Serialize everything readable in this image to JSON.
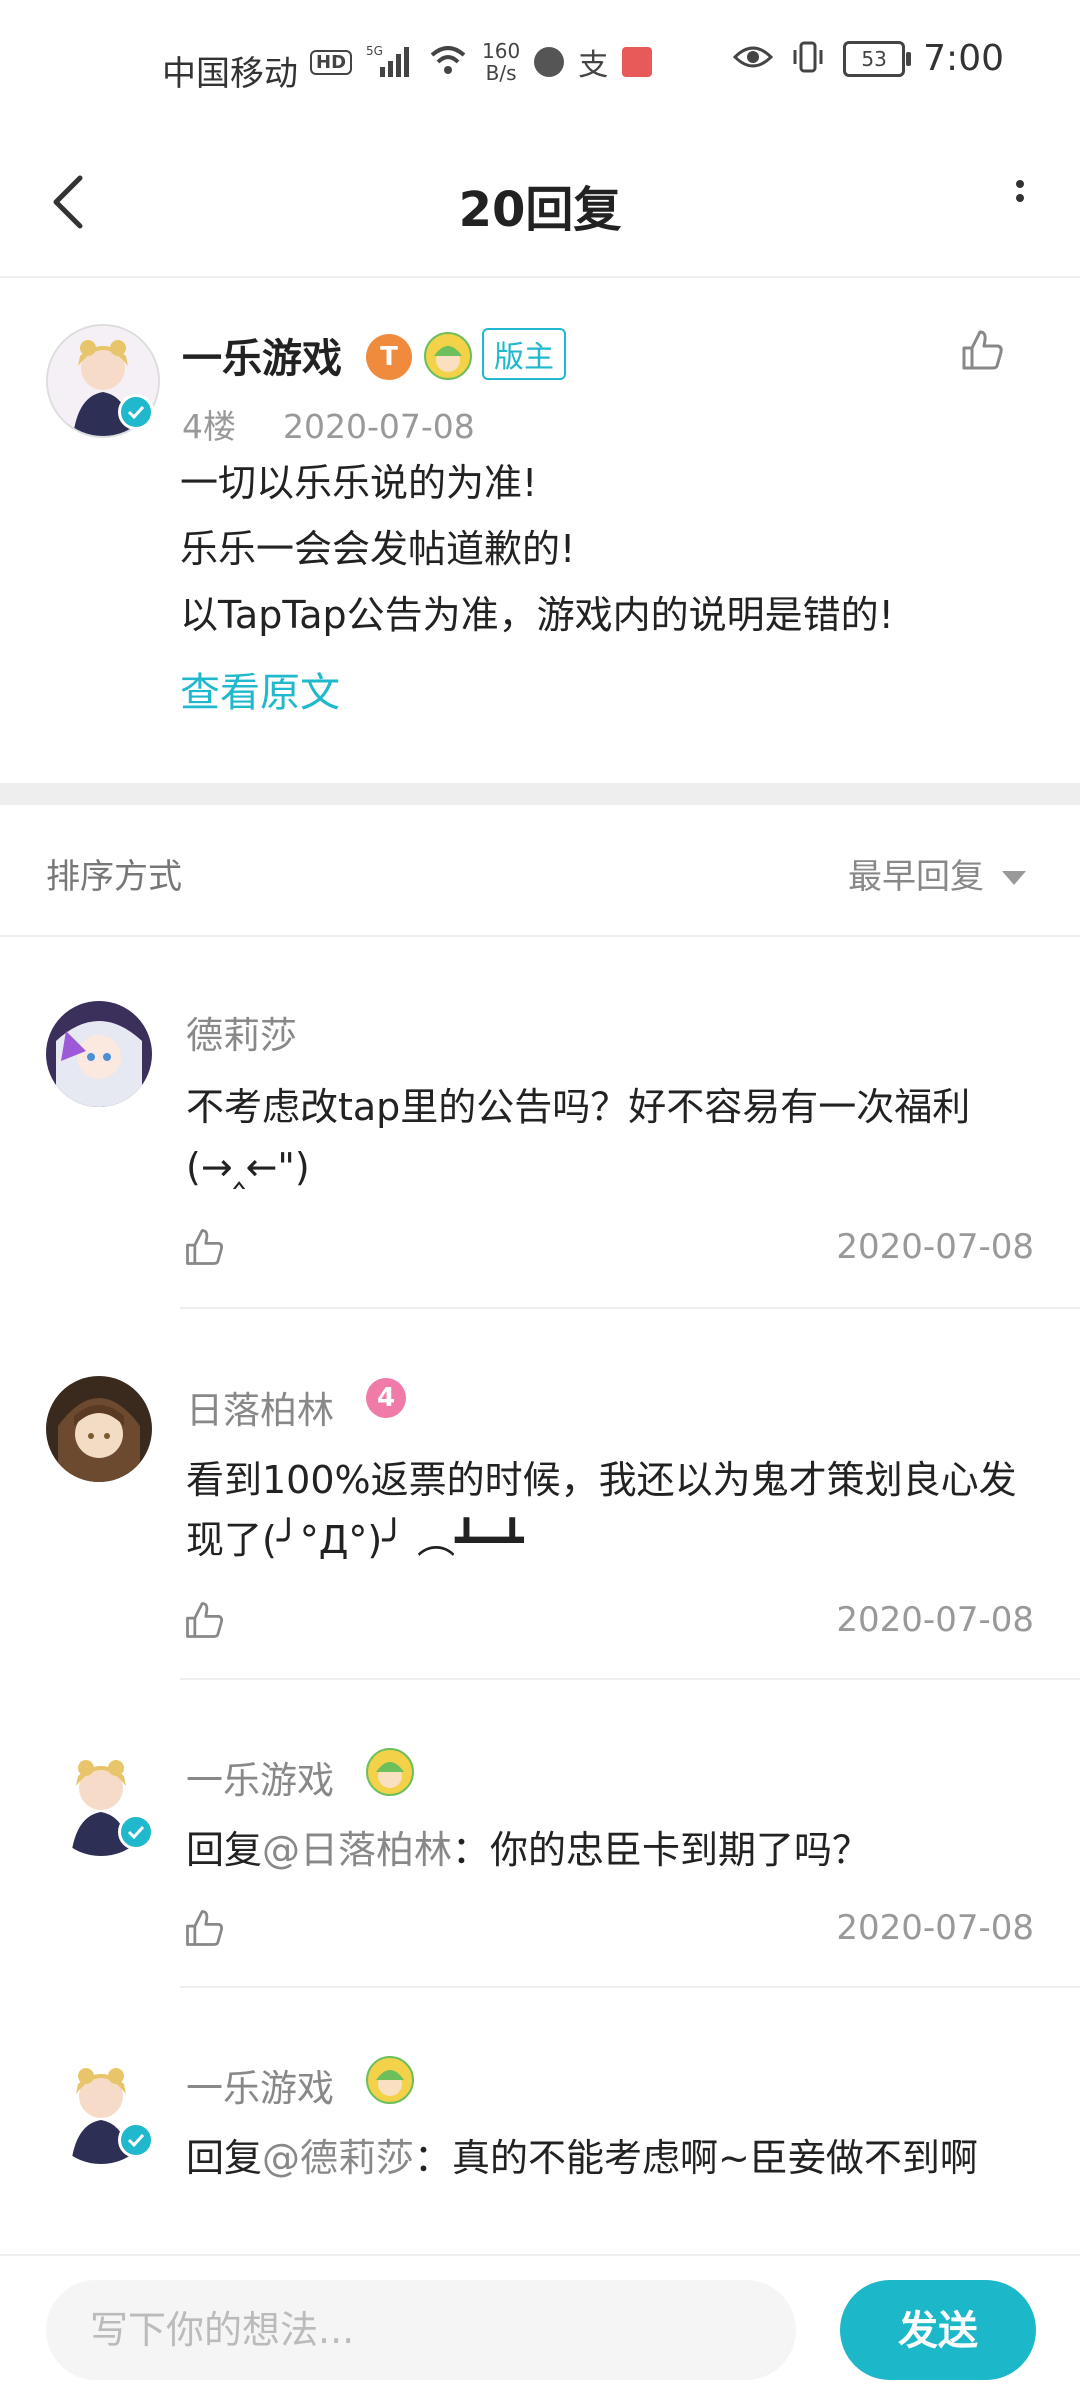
{
  "status_bar": {
    "carrier": "中国移动",
    "hd": "HD",
    "network": "5G",
    "speed_value": "160",
    "speed_unit": "B/s",
    "battery": "53",
    "time": "7:00"
  },
  "header": {
    "title": "20回复"
  },
  "post": {
    "author": "一乐游戏",
    "level_badge": "T",
    "moderator_tag": "版主",
    "floor": "4楼",
    "date": "2020-07-08",
    "lines": [
      "一切以乐乐说的为准!",
      "乐乐一会会发帖道歉的!",
      "以TapTap公告为准，游戏内的说明是错的!"
    ],
    "view_original": "查看原文"
  },
  "sort": {
    "label": "排序方式",
    "value": "最早回复"
  },
  "comments": [
    {
      "name": "德莉莎",
      "text": "不考虑改tap里的公告吗？好不容易有一次福利(→‸←\")",
      "date": "2020-07-08"
    },
    {
      "name": "日落柏林",
      "level": "4",
      "text": "看到100%返票的时候，我还以为鬼才策划良心发现了(╯°Д°)╯ ︵┻━┻",
      "date": "2020-07-08"
    },
    {
      "name": "一乐游戏",
      "reply_prefix": "回复",
      "mention": "@日落柏林",
      "text": "：你的忠臣卡到期了吗？",
      "date": "2020-07-08"
    },
    {
      "name": "一乐游戏",
      "reply_prefix": "回复",
      "mention": "@德莉莎",
      "text": "：真的不能考虑啊~臣妾做不到啊"
    }
  ],
  "composer": {
    "placeholder": "写下你的想法...",
    "send_label": "发送"
  },
  "colors": {
    "accent": "#1cb7c8",
    "level_badge": "#f07aa8",
    "t_badge": "#f08a3c"
  }
}
